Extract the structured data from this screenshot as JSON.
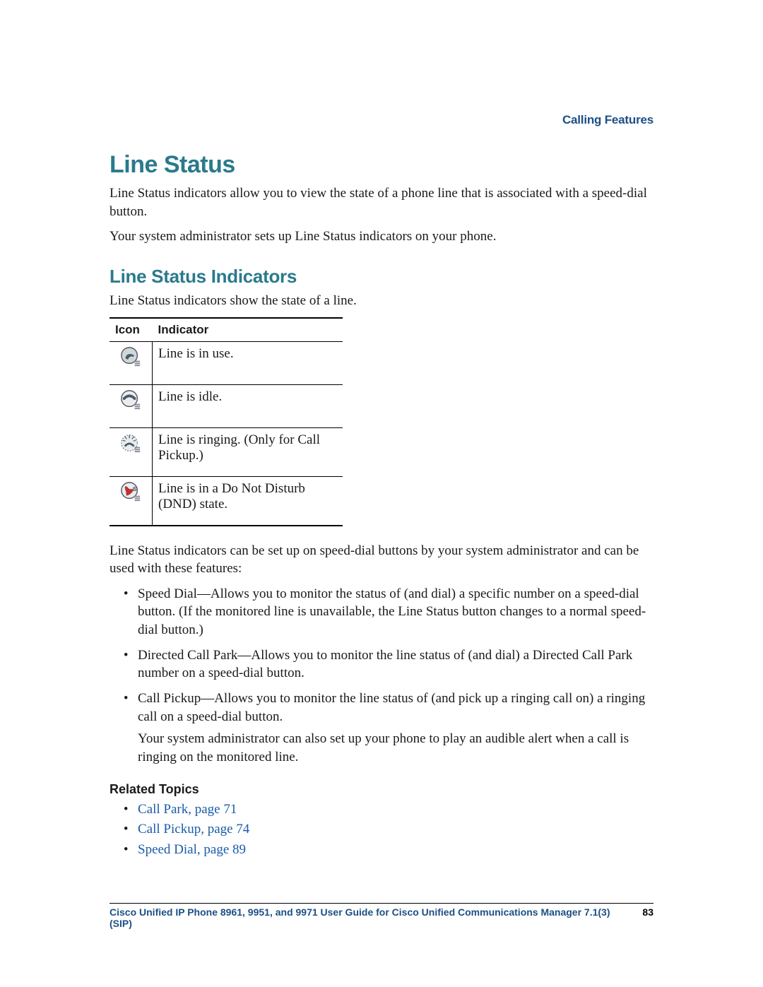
{
  "header": {
    "chapter": "Calling Features"
  },
  "section": {
    "title": "Line Status",
    "intro1": "Line Status indicators allow you to view the state of a phone line that is associated with a speed-dial button.",
    "intro2": "Your system administrator sets up Line Status indicators on your phone."
  },
  "subsection": {
    "title": "Line Status Indicators",
    "lead": "Line Status indicators show the state of a line."
  },
  "table": {
    "headers": {
      "icon": "Icon",
      "indicator": "Indicator"
    },
    "rows": [
      {
        "icon_name": "line-in-use-icon",
        "indicator": "Line is in use."
      },
      {
        "icon_name": "line-idle-icon",
        "indicator": "Line is idle."
      },
      {
        "icon_name": "line-ringing-icon",
        "indicator": "Line is ringing. (Only for Call Pickup.)"
      },
      {
        "icon_name": "line-dnd-icon",
        "indicator": "Line is in a Do Not Disturb (DND) state."
      }
    ]
  },
  "post_table": {
    "lead": "Line Status indicators can be set up on speed-dial buttons by your system administrator and can be used with these features:",
    "bullets": [
      {
        "text": "Speed Dial—Allows you to monitor the status of (and dial) a specific number on a speed-dial button. (If the monitored line is unavailable, the Line Status button changes to a normal speed-dial button.)"
      },
      {
        "text": "Directed Call Park—Allows you to monitor the line status of (and dial) a Directed Call Park number on a speed-dial button."
      },
      {
        "text": "Call Pickup—Allows you to monitor the line status of (and pick up a ringing call on) a ringing call on a speed-dial button.",
        "extra": "Your system administrator can also set up your phone to play an audible alert when a call is ringing on the monitored line."
      }
    ]
  },
  "related": {
    "heading": "Related Topics",
    "links": [
      {
        "label": "Call Park, page 71"
      },
      {
        "label": "Call Pickup, page 74"
      },
      {
        "label": "Speed Dial, page 89"
      }
    ]
  },
  "footer": {
    "doc_title": "Cisco Unified IP Phone 8961, 9951, and 9971 User Guide for Cisco Unified Communications Manager 7.1(3) (SIP)",
    "page_number": "83"
  }
}
